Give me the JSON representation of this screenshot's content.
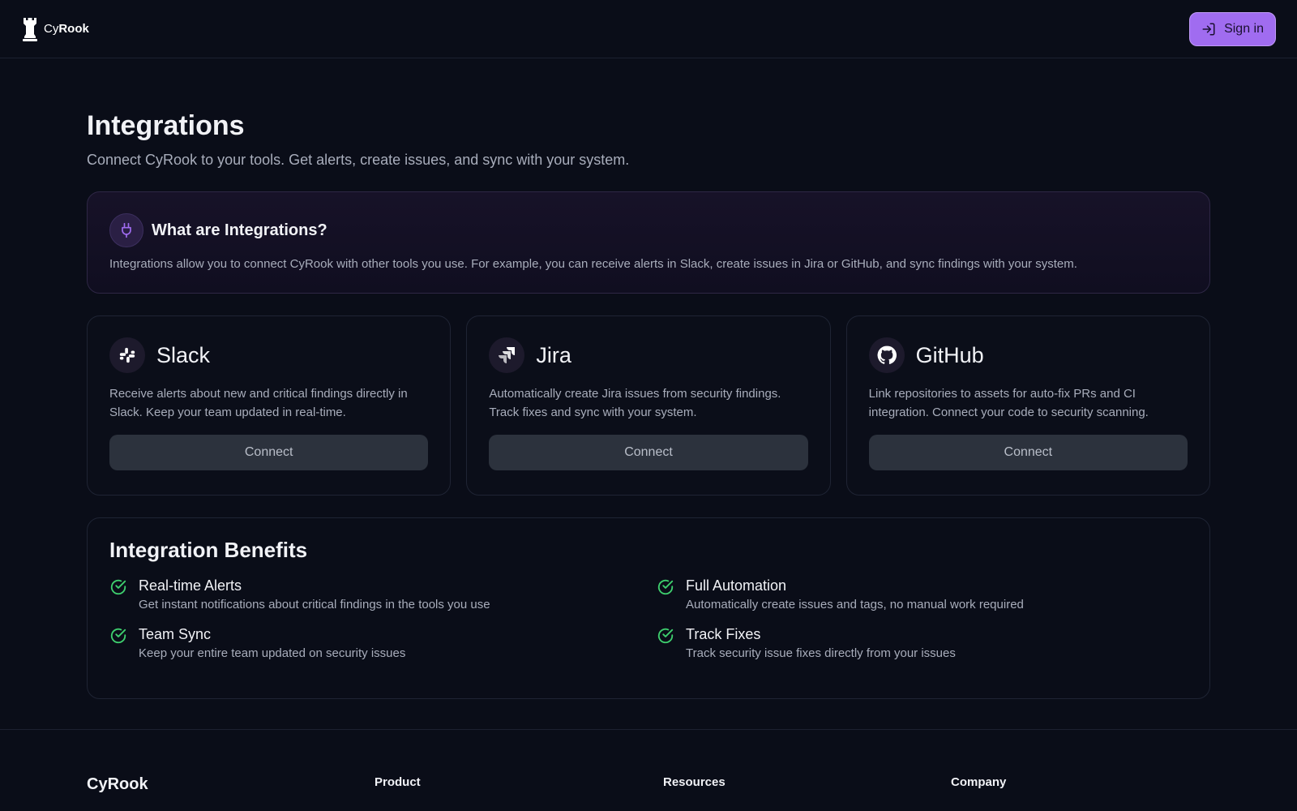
{
  "header": {
    "brand_prefix": "Cy",
    "brand_suffix": "Rook",
    "signin_label": "Sign in"
  },
  "page": {
    "title": "Integrations",
    "subtitle": "Connect CyRook to your tools. Get alerts, create issues, and sync with your system."
  },
  "info": {
    "title": "What are Integrations?",
    "text": "Integrations allow you to connect CyRook with other tools you use. For example, you can receive alerts in Slack, create issues in Jira or GitHub, and sync findings with your system."
  },
  "integrations": [
    {
      "name": "Slack",
      "icon": "slack-icon",
      "description": "Receive alerts about new and critical findings directly in Slack. Keep your team updated in real-time.",
      "button": "Connect"
    },
    {
      "name": "Jira",
      "icon": "jira-icon",
      "description": "Automatically create Jira issues from security findings. Track fixes and sync with your system.",
      "button": "Connect"
    },
    {
      "name": "GitHub",
      "icon": "github-icon",
      "description": "Link repositories to assets for auto-fix PRs and CI integration. Connect your code to security scanning.",
      "button": "Connect"
    }
  ],
  "benefits": {
    "title": "Integration Benefits",
    "items": [
      {
        "title": "Real-time Alerts",
        "description": "Get instant notifications about critical findings in the tools you use"
      },
      {
        "title": "Full Automation",
        "description": "Automatically create issues and tags, no manual work required"
      },
      {
        "title": "Team Sync",
        "description": "Keep your entire team updated on security issues"
      },
      {
        "title": "Track Fixes",
        "description": "Track security issue fixes directly from your issues"
      }
    ]
  },
  "footer": {
    "brand": "CyRook",
    "columns": [
      {
        "heading": "Product"
      },
      {
        "heading": "Resources"
      },
      {
        "heading": "Company"
      }
    ]
  },
  "colors": {
    "accent": "#a06cf0",
    "background": "#0a0d18",
    "success": "#3ecf6e"
  }
}
